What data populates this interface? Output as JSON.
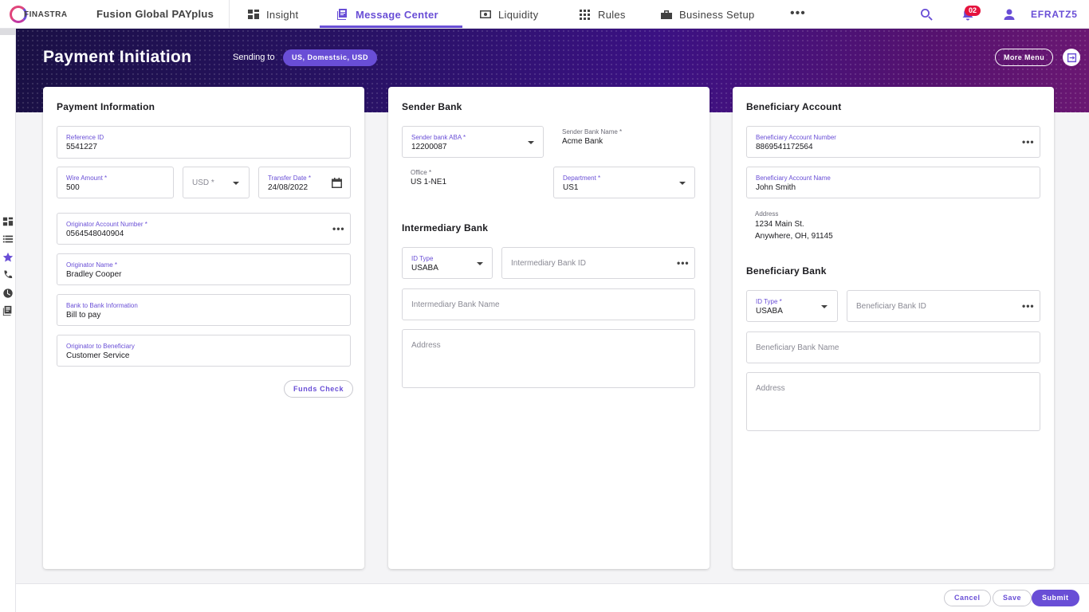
{
  "brand": {
    "logo_text": "FINASTRA",
    "product": "Fusion Global PAYplus",
    "accent": "#694ed6"
  },
  "nav": {
    "items": [
      {
        "label": "Insight",
        "icon": "dashboard-icon"
      },
      {
        "label": "Message Center",
        "icon": "message-center-icon",
        "active": true
      },
      {
        "label": "Liquidity",
        "icon": "money-icon"
      },
      {
        "label": "Rules",
        "icon": "grid-icon"
      },
      {
        "label": "Business Setup",
        "icon": "business-icon"
      }
    ],
    "more": "•••",
    "notifications_count": "02",
    "username": "EFRATZ5"
  },
  "header": {
    "title": "Payment Initiation",
    "sending_label": "Sending to",
    "sending_chip": "US, Domestsic, USD",
    "more_menu": "More Menu"
  },
  "payment_info": {
    "title": "Payment Information",
    "reference_id": {
      "label": "Reference ID",
      "value": "5541227"
    },
    "wire_amount": {
      "label": "Wire Amount *",
      "value": "500"
    },
    "currency": {
      "placeholder": "USD *"
    },
    "transfer_date": {
      "label": "Transfer Date *",
      "value": "24/08/2022"
    },
    "originator_account": {
      "label": "Originator Account Number *",
      "value": "0564548040904"
    },
    "originator_name": {
      "label": "Originator Name *",
      "value": "Bradley Cooper"
    },
    "bank_to_bank": {
      "label": "Bank to Bank Information",
      "value": "Bill to pay"
    },
    "originator_to_beneficiary": {
      "label": "Originator to Beneficiary",
      "value": "Customer Service"
    },
    "funds_check": "Funds Check"
  },
  "sender_bank": {
    "title": "Sender Bank",
    "aba": {
      "label": "Sender bank ABA *",
      "value": "12200087"
    },
    "bank_name": {
      "label": "Sender Bank Name *",
      "value": "Acme Bank"
    },
    "office": {
      "label": "Office *",
      "value": "US 1-NE1"
    },
    "department": {
      "label": "Department *",
      "value": "US1"
    }
  },
  "intermediary_bank": {
    "title": "Intermediary Bank",
    "id_type": {
      "label": "ID Type",
      "value": "USABA"
    },
    "bank_id": {
      "placeholder": "Intermediary Bank ID"
    },
    "bank_name": {
      "placeholder": "Intermediary Bank Name"
    },
    "address": {
      "placeholder": "Address"
    }
  },
  "beneficiary_account": {
    "title": "Beneficiary Account",
    "account_number": {
      "label": "Beneficiary Account Number",
      "value": "8869541172564"
    },
    "account_name": {
      "label": "Beneficiary Account Name",
      "value": "John Smith"
    },
    "address": {
      "label": "Address",
      "line1": "1234 Main St.",
      "line2": "Anywhere, OH, 91145"
    }
  },
  "beneficiary_bank": {
    "title": "Beneficiary Bank",
    "id_type": {
      "label": "ID Type *",
      "value": "USABA"
    },
    "bank_id": {
      "placeholder": "Beneficiary Bank ID"
    },
    "bank_name": {
      "placeholder": "Beneficiary Bank Name"
    },
    "address": {
      "placeholder": "Address"
    }
  },
  "footer": {
    "cancel": "Cancel",
    "save": "Save",
    "submit": "Submit"
  }
}
